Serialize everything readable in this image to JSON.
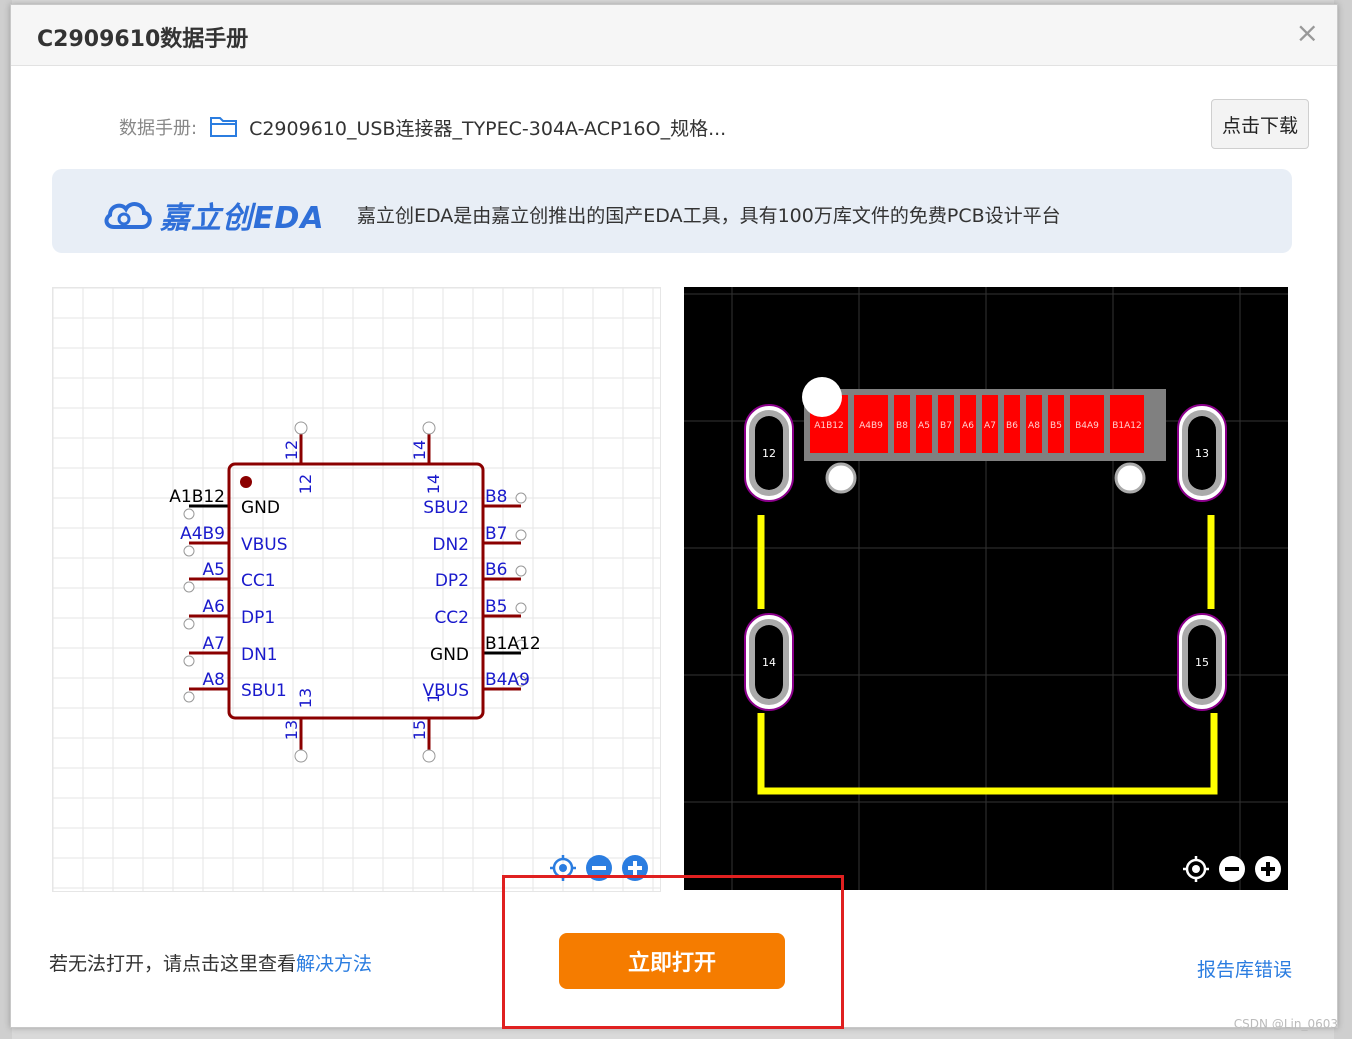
{
  "dialog": {
    "title": "C2909610数据手册",
    "close_glyph": "×"
  },
  "datasheet": {
    "label": "数据手册:",
    "file": "C2909610_USB连接器_TYPEC-304A-ACP16O_规格...",
    "download_label": "点击下载",
    "folder_icon": "folder-icon"
  },
  "banner": {
    "logo_text": "嘉立创EDA",
    "text": "嘉立创EDA是由嘉立创推出的国产EDA工具，具有100万库文件的免费PCB设计平台"
  },
  "schematic": {
    "top_pins": [
      "12",
      "14"
    ],
    "bottom_pins": [
      "13",
      "15"
    ],
    "inner_top": [
      "12",
      "14"
    ],
    "inner_bottom": [
      "13",
      "1"
    ],
    "left_nets": [
      "A1B12",
      "A4B9",
      "A5",
      "A6",
      "A7",
      "A8"
    ],
    "left_pins": [
      "GND",
      "VBUS",
      "CC1",
      "DP1",
      "DN1",
      "SBU1"
    ],
    "right_nets": [
      "B8",
      "B7",
      "B6",
      "B5",
      "B1A12",
      "B4A9"
    ],
    "right_pins": [
      "SBU2",
      "DN2",
      "DP2",
      "CC2",
      "GND",
      "VBUS"
    ],
    "colors": {
      "body": "#8b0000",
      "label": "#1a1acc",
      "grid": "#e6e6e6"
    }
  },
  "pcb": {
    "pads": [
      "A1B12",
      "A4B9",
      "B8",
      "A5",
      "B7",
      "A6",
      "A7",
      "B6",
      "A8",
      "B5",
      "B4A9",
      "B1A12"
    ],
    "holes": [
      "12",
      "13",
      "14",
      "15"
    ],
    "colors": {
      "pad": "#ff0000",
      "trace": "#ffff00",
      "board": "#000000",
      "hole_ring": "#cccccc"
    }
  },
  "view_controls": [
    "locate-icon",
    "zoom-out-icon",
    "zoom-in-icon"
  ],
  "footer": {
    "help_text": "若无法打开，请点击这里查看",
    "help_link": "解决方法",
    "open_label": "立即打开",
    "report_label": "报告库错误"
  },
  "watermark": "CSDN @Lin_0603"
}
